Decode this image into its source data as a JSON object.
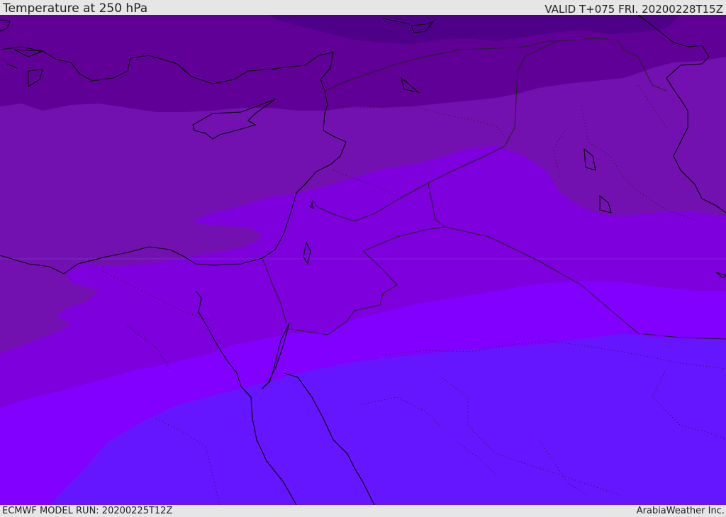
{
  "header": {
    "title": "Temperature at 250 hPa",
    "valid": "VALID T+075 FRI. 20200228T15Z"
  },
  "footer": {
    "model_run": "ECMWF MODEL RUN: 20200225T12Z",
    "brand": "ArabiaWeather Inc."
  },
  "map": {
    "colors": {
      "band_darkest": "#4e0088",
      "band_dark": "#610096",
      "band_mid_dark": "#7311b0",
      "band_mid": "#7d00dd",
      "band_bright": "#8200ff",
      "band_blue": "#6616ff",
      "coastline": "#000000",
      "border": "#222222"
    }
  }
}
